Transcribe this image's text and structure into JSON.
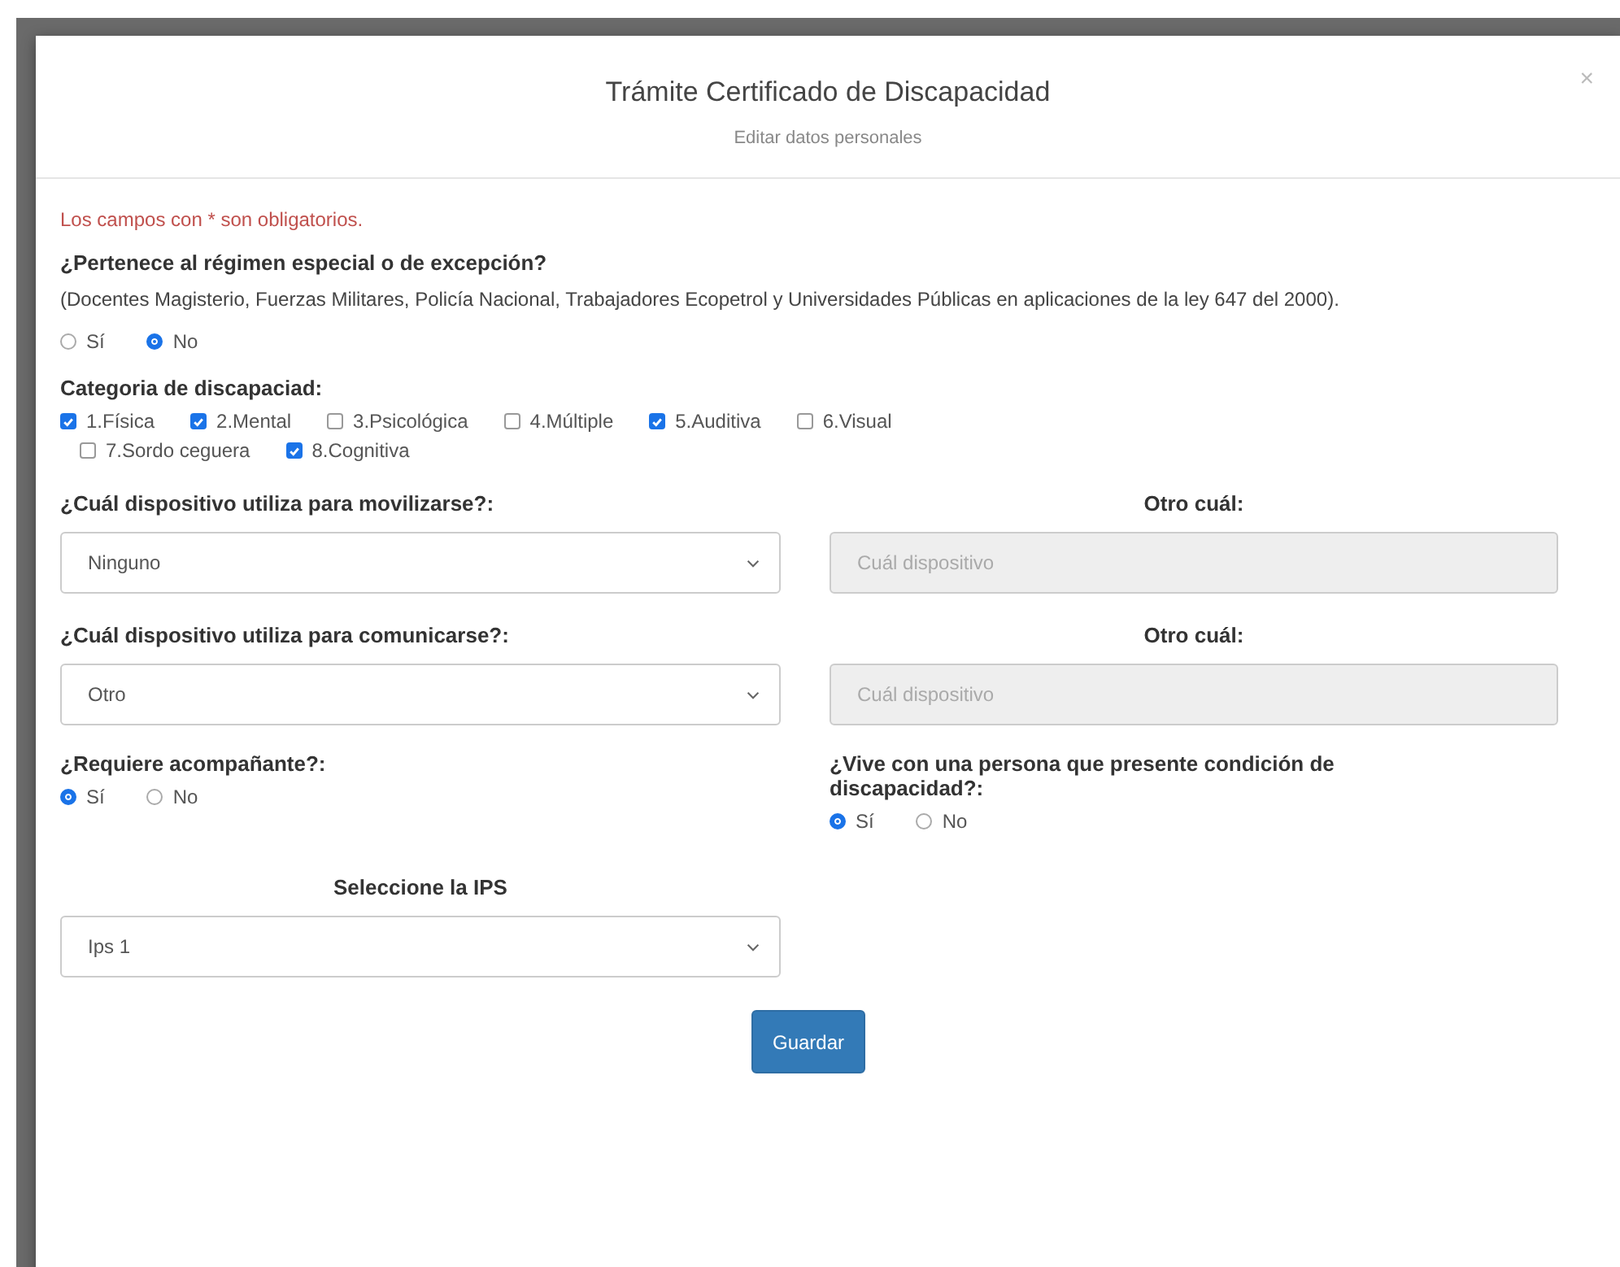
{
  "modal": {
    "title": "Trámite Certificado de Discapacidad",
    "subtitle": "Editar datos personales",
    "close": "×"
  },
  "required_note": "Los campos con * son obligatorios.",
  "regime": {
    "label": "¿Pertenece al régimen especial o de excepción?",
    "help": "(Docentes Magisterio, Fuerzas Militares, Policía Nacional, Trabajadores Ecopetrol y Universidades Públicas en aplicaciones de la ley 647 del 2000).",
    "options": [
      {
        "label": "Sí",
        "selected": false
      },
      {
        "label": "No",
        "selected": true
      }
    ]
  },
  "category": {
    "label": "Categoria de discapaciad:",
    "options": [
      {
        "label": "1.Física",
        "checked": true
      },
      {
        "label": "2.Mental",
        "checked": true
      },
      {
        "label": "3.Psicológica",
        "checked": false
      },
      {
        "label": "4.Múltiple",
        "checked": false
      },
      {
        "label": "5.Auditiva",
        "checked": true
      },
      {
        "label": "6.Visual",
        "checked": false
      },
      {
        "label": "7.Sordo ceguera",
        "checked": false
      },
      {
        "label": "8.Cognitiva",
        "checked": true
      }
    ]
  },
  "devices": [
    {
      "label": "¿Cuál dispositivo utiliza para movilizarse?:",
      "value": "Ninguno",
      "other_label": "Otro cuál:",
      "other_placeholder": "Cuál dispositivo",
      "other_disabled": true
    },
    {
      "label": "¿Cuál dispositivo utiliza para comunicarse?:",
      "value": "Otro",
      "other_label": "Otro cuál:",
      "other_placeholder": "Cuál dispositivo",
      "other_disabled": true
    }
  ],
  "companion": {
    "label": "¿Requiere acompañante?:",
    "options": [
      {
        "label": "Sí",
        "selected": true
      },
      {
        "label": "No",
        "selected": false
      }
    ]
  },
  "lives_with": {
    "label": "¿Vive con una persona que presente condición de discapacidad?:",
    "options": [
      {
        "label": "Sí",
        "selected": true
      },
      {
        "label": "No",
        "selected": false
      }
    ]
  },
  "ips": {
    "label": "Seleccione la IPS",
    "value": "Ips 1"
  },
  "save_button": "Guardar"
}
